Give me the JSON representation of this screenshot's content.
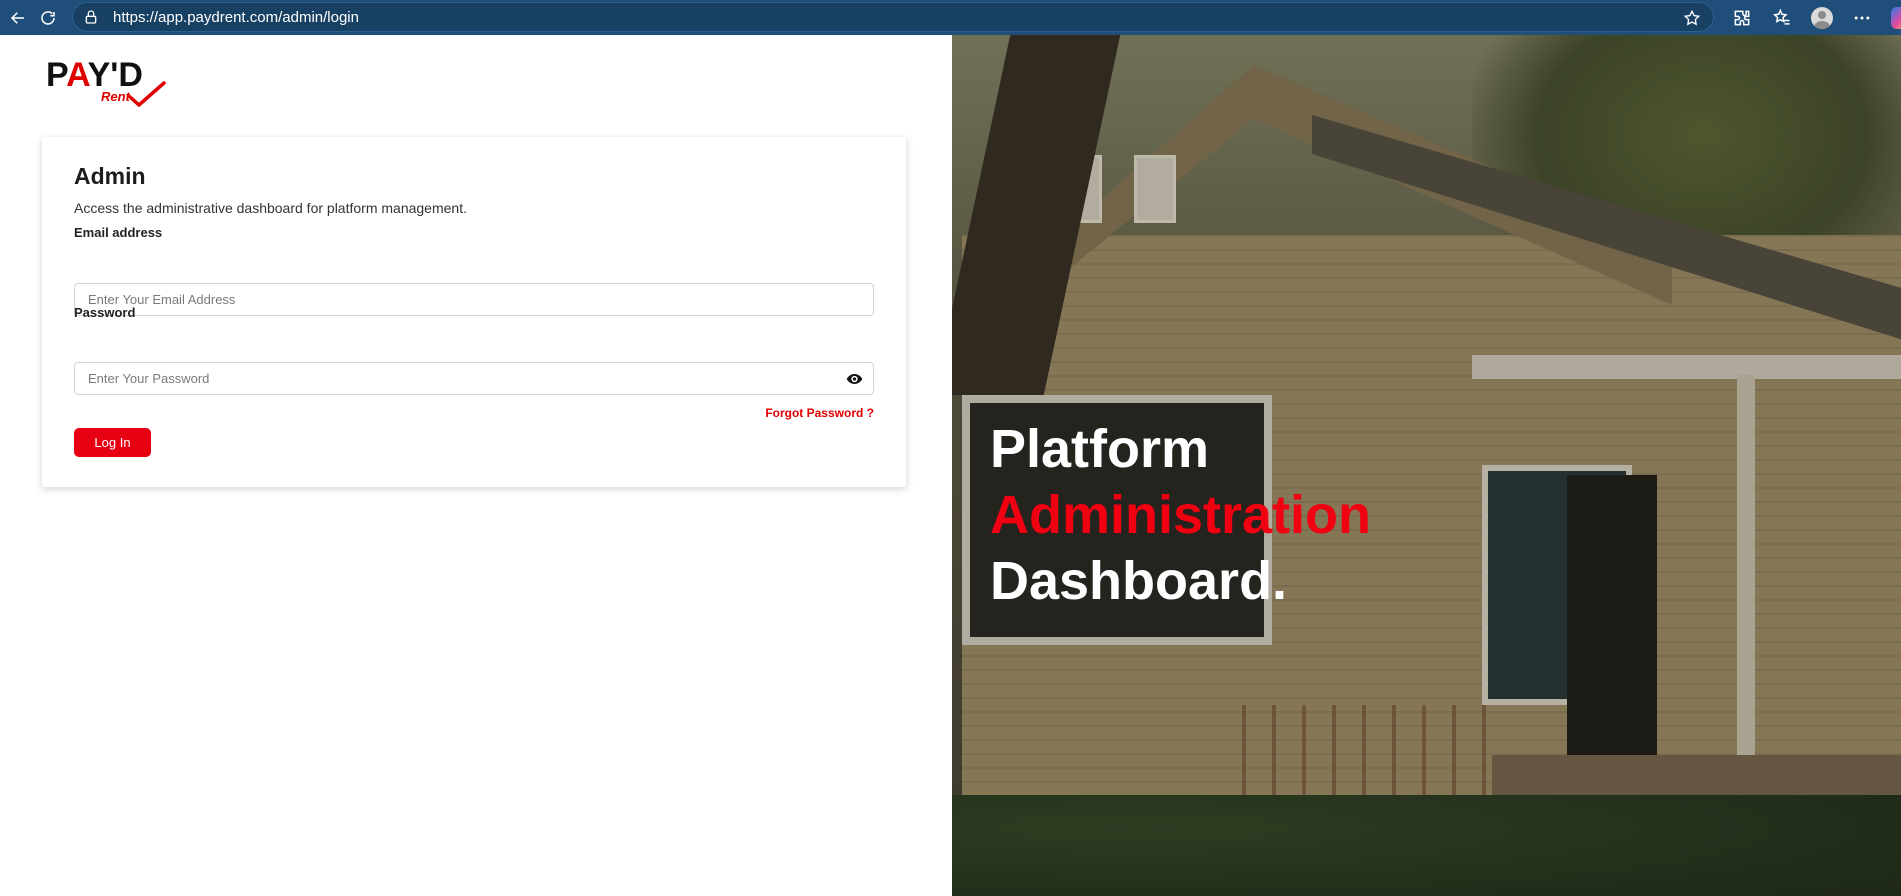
{
  "browser": {
    "url": "https://app.paydrent.com/admin/login"
  },
  "logo": {
    "main_pre": "P",
    "main_a": "A",
    "main_post": "Y'D",
    "sub": "Rent"
  },
  "card": {
    "title": "Admin",
    "subtitle": "Access the administrative dashboard for platform management.",
    "email_label": "Email address",
    "email_placeholder": "Enter Your Email Address",
    "password_label": "Password",
    "password_placeholder": "Enter Your Password",
    "forgot_label": "Forgot Password ?",
    "login_label": "Log In"
  },
  "hero": {
    "line1": "Platform",
    "line2": "Administration",
    "line3": "Dashboard."
  },
  "colors": {
    "brand_red": "#e60012",
    "browser_bar": "#1f4e7a"
  },
  "icons": [
    "back-arrow-icon",
    "refresh-icon",
    "lock-icon",
    "star-icon",
    "extensions-icon",
    "favorites-icon",
    "profile-avatar",
    "more-icon",
    "copilot-icon",
    "eye-icon"
  ]
}
